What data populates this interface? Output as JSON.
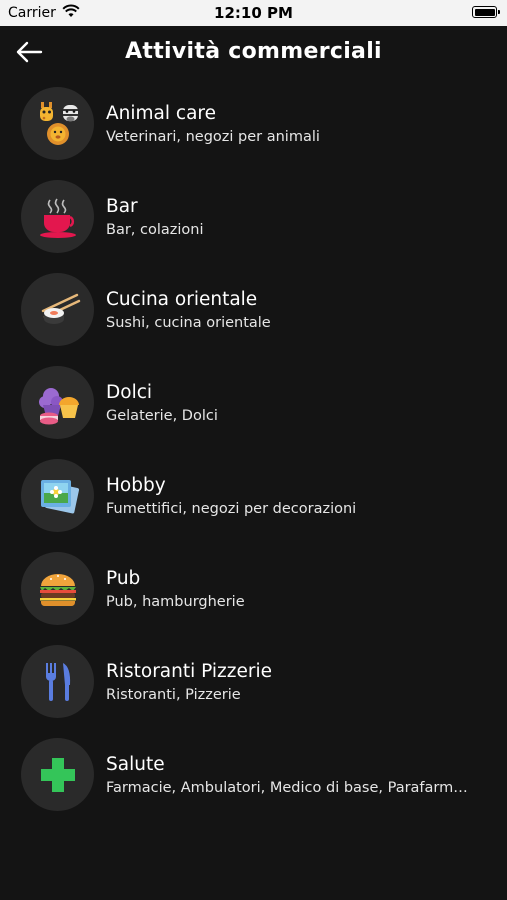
{
  "status_bar": {
    "carrier": "Carrier",
    "time": "12:10 PM"
  },
  "header": {
    "title": "Attività commerciali"
  },
  "categories": [
    {
      "title": "Animal care",
      "subtitle": "Veterinari, negozi per animali",
      "icon": "animals-icon"
    },
    {
      "title": "Bar",
      "subtitle": "Bar, colazioni",
      "icon": "coffee-cup-icon"
    },
    {
      "title": "Cucina orientale",
      "subtitle": "Sushi, cucina orientale",
      "icon": "sushi-icon"
    },
    {
      "title": "Dolci",
      "subtitle": "Gelaterie, Dolci",
      "icon": "sweets-icon"
    },
    {
      "title": "Hobby",
      "subtitle": "Fumettifici, negozi per decorazioni",
      "icon": "photo-icon"
    },
    {
      "title": "Pub",
      "subtitle": "Pub, hamburgherie",
      "icon": "burger-icon"
    },
    {
      "title": "Ristoranti Pizzerie",
      "subtitle": "Ristoranti, Pizzerie",
      "icon": "cutlery-icon"
    },
    {
      "title": "Salute",
      "subtitle": "Farmacie, Ambulatori, Medico di base, Parafarmacie",
      "icon": "medical-cross-icon"
    }
  ]
}
